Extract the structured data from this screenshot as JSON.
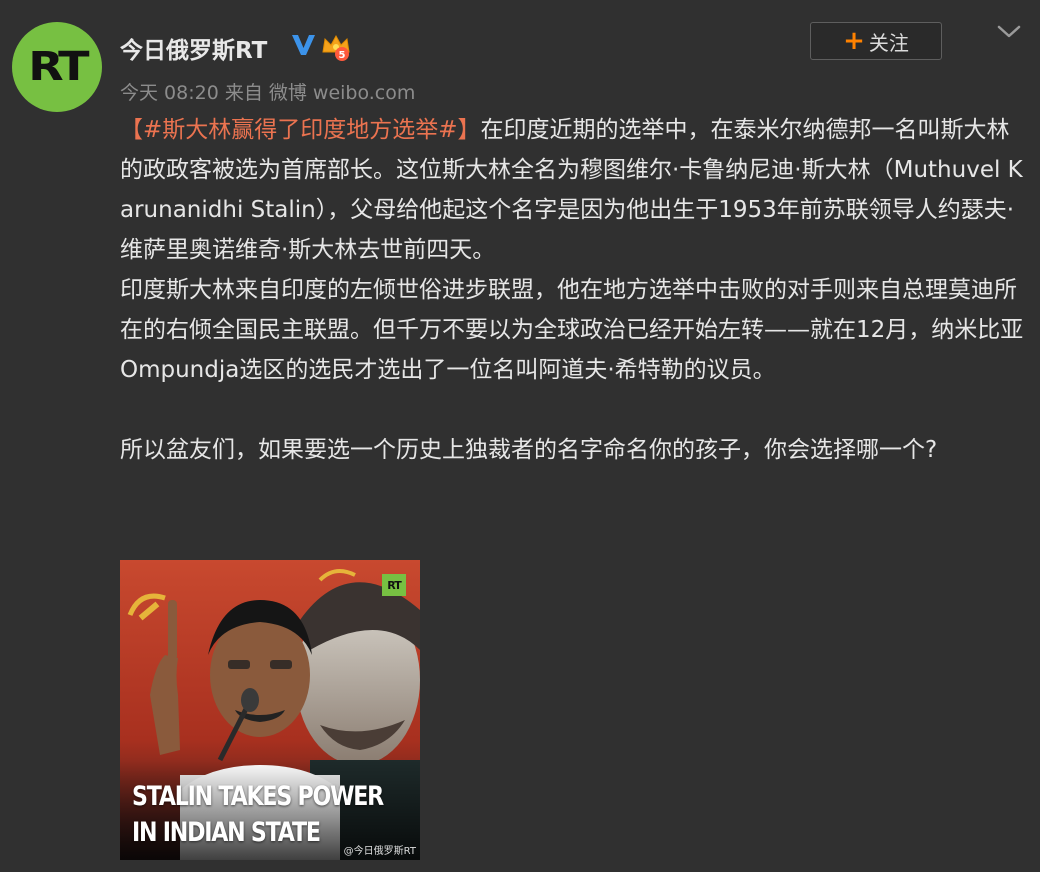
{
  "post": {
    "author": {
      "name": "今日俄罗斯RT",
      "avatar_text": "RT",
      "verified_icon": "verified-v-icon",
      "vip_icon": "vip-crown-icon",
      "vip_level": "5"
    },
    "meta": "今天 08:20 来自 微博 weibo.com",
    "follow": {
      "plus": "+",
      "label": "关注"
    },
    "menu_icon": "chevron-down-icon",
    "content": {
      "hashtag": "【#斯大林赢得了印度地方选举#】",
      "p1_rest": "在印度近期的选举中，在泰米尔纳德邦一名叫斯大林的政政客被选为首席部长。这位斯大林全名为穆图维尔·卡鲁纳尼迪·斯大林（Muthuvel Karunanidhi Stalin），父母给他起这个名字是因为他出生于1953年前苏联领导人约瑟夫·维萨里奥诺维奇·斯大林去世前四天。",
      "p2": "印度斯大林来自印度的左倾世俗进步联盟，他在地方选举中击败的对手则来自总理莫迪所在的右倾全国民主联盟。但千万不要以为全球政治已经开始左转——就在12月，纳米比亚Ompundja选区的选民才选出了一位名叫阿道夫·希特勒的议员。",
      "p3": "所以盆友们，如果要选一个历史上独裁者的名字命名你的孩子，你会选择哪一个?"
    },
    "image": {
      "headline_line1": "STALIN TAKES POWER",
      "headline_line2": "IN INDIAN STATE",
      "logo_text": "RT",
      "watermark": "@今日俄罗斯RT"
    },
    "colors": {
      "background": "#303030",
      "hashtag": "#eb7350",
      "follow_plus": "#ff8200",
      "rt_green": "#77c042",
      "verified_blue": "#3c93ea"
    }
  }
}
